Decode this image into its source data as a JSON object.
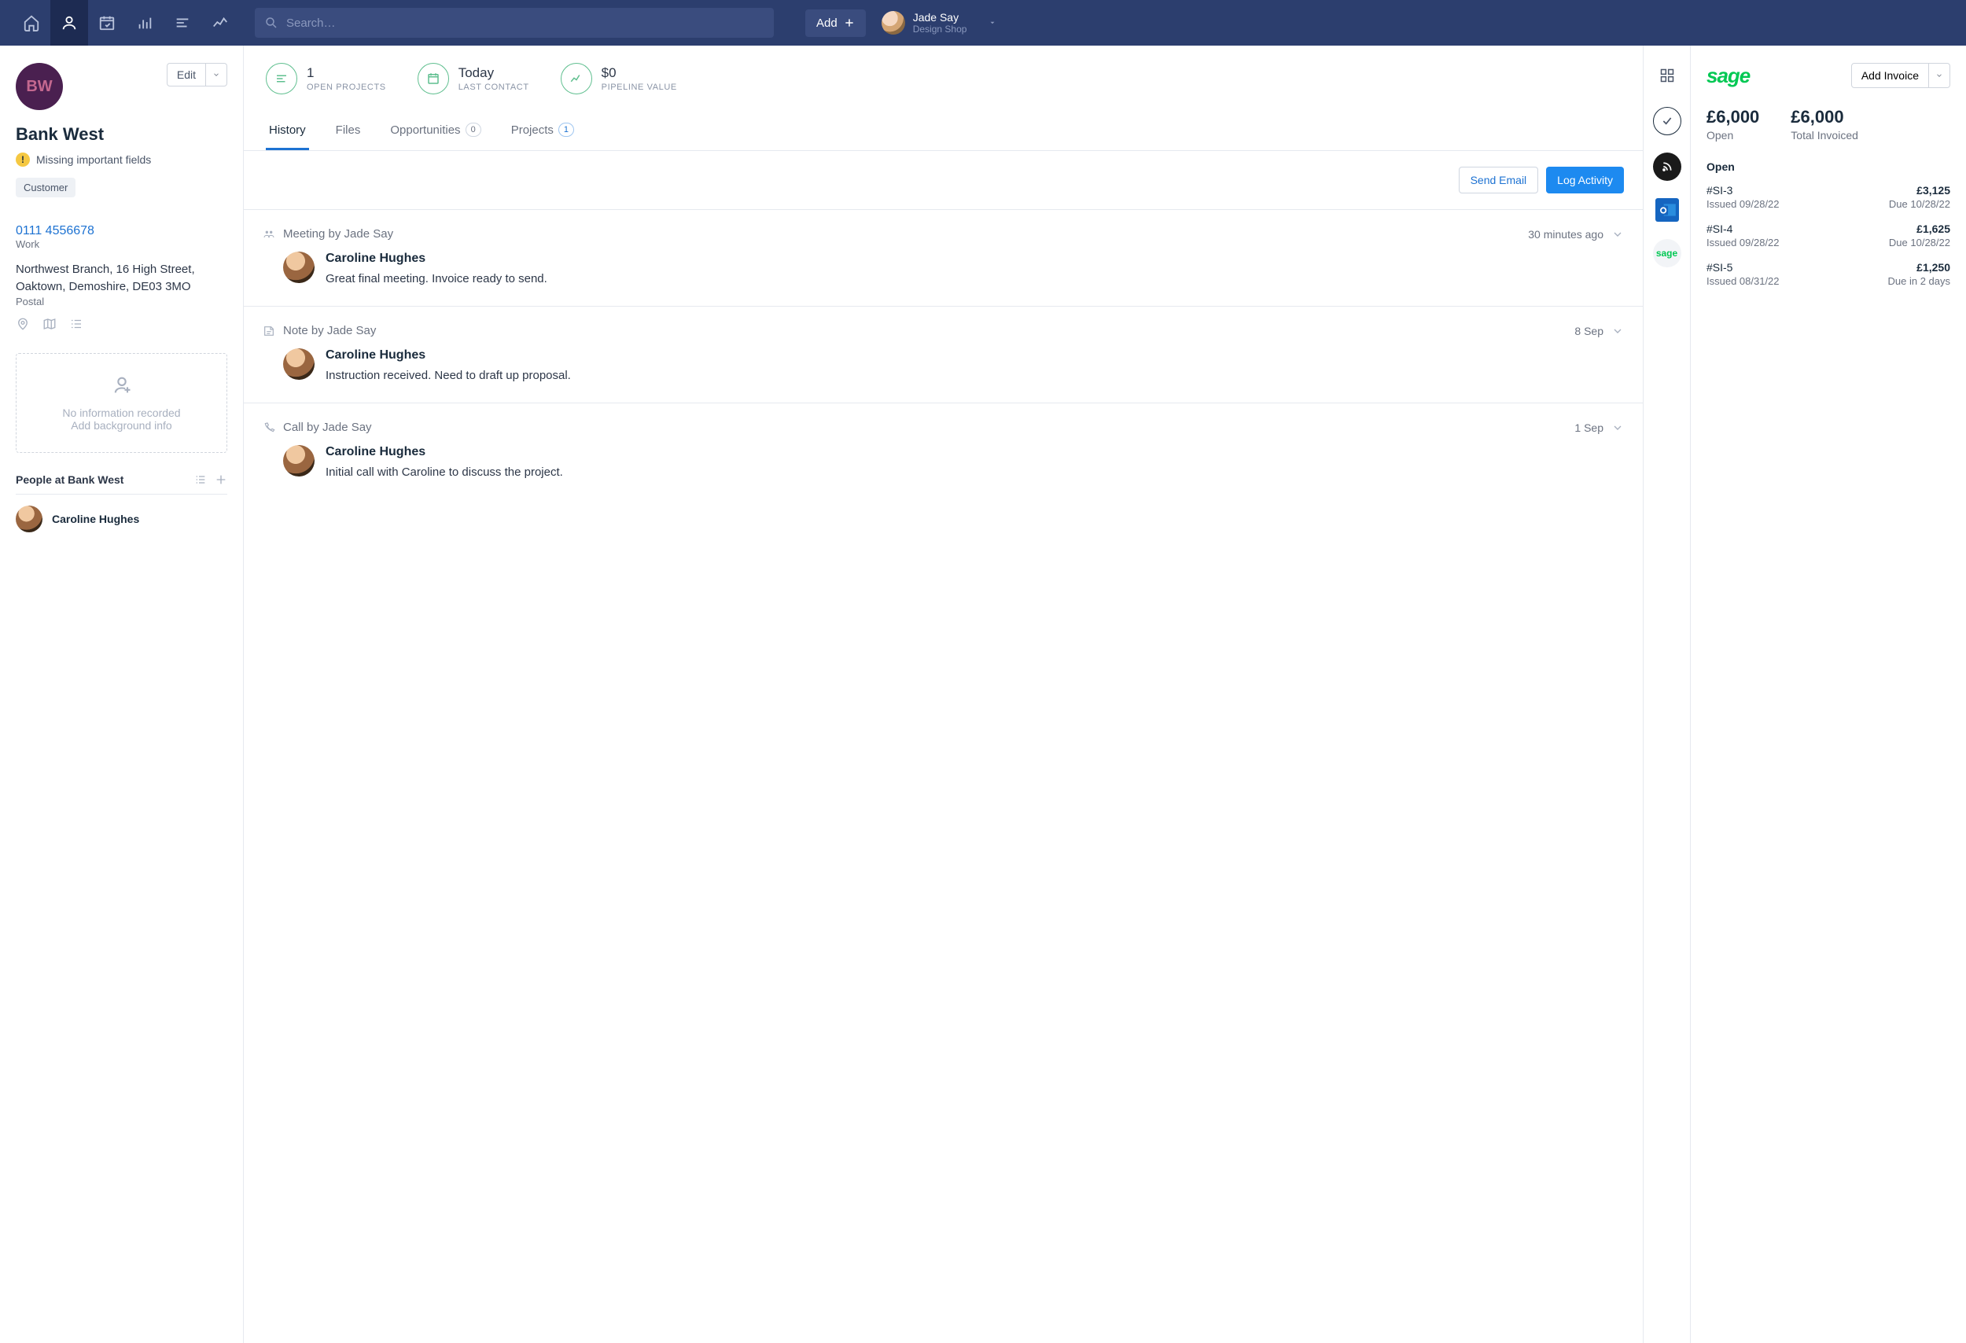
{
  "topbar": {
    "search_placeholder": "Search…",
    "add_label": "Add",
    "user_name": "Jade Say",
    "user_shop": "Design Shop"
  },
  "org": {
    "initials": "BW",
    "name": "Bank West",
    "edit_label": "Edit",
    "alert_text": "Missing important fields",
    "tag": "Customer",
    "phone": "0111 4556678",
    "phone_label": "Work",
    "address_line1": "Northwest Branch, 16 High Street,",
    "address_line2": "Oaktown, Demoshire, DE03 3MO",
    "address_label": "Postal",
    "empty_line1": "No information recorded",
    "empty_line2": "Add background info"
  },
  "people": {
    "heading": "People at Bank West",
    "items": [
      "Caroline Hughes"
    ]
  },
  "kpis": {
    "projects_val": "1",
    "projects_lbl": "Open Projects",
    "contact_val": "Today",
    "contact_lbl": "Last Contact",
    "pipeline_val": "$0",
    "pipeline_lbl": "Pipeline Value"
  },
  "tabs": {
    "history": "History",
    "files": "Files",
    "opportunities": "Opportunities",
    "opportunities_count": "0",
    "projects": "Projects",
    "projects_count": "1"
  },
  "timeline": {
    "send_email": "Send Email",
    "log_activity": "Log Activity",
    "items": [
      {
        "type": "Meeting by Jade Say",
        "time": "30 minutes ago",
        "person": "Caroline Hughes",
        "text": "Great final meeting. Invoice ready to send."
      },
      {
        "type": "Note by Jade Say",
        "time": "8 Sep",
        "person": "Caroline Hughes",
        "text": "Instruction received. Need to draft up proposal."
      },
      {
        "type": "Call by Jade Say",
        "time": "1 Sep",
        "person": "Caroline Hughes",
        "text": "Initial call with Caroline to discuss the project."
      }
    ]
  },
  "sage": {
    "logo": "sage",
    "add_invoice": "Add Invoice",
    "open_val": "£6,000",
    "open_lbl": "Open",
    "invoiced_val": "£6,000",
    "invoiced_lbl": "Total Invoiced",
    "section": "Open",
    "invoices": [
      {
        "id": "#SI-3",
        "issued": "Issued 09/28/22",
        "amount": "£3,125",
        "due": "Due 10/28/22"
      },
      {
        "id": "#SI-4",
        "issued": "Issued 09/28/22",
        "amount": "£1,625",
        "due": "Due 10/28/22"
      },
      {
        "id": "#SI-5",
        "issued": "Issued 08/31/22",
        "amount": "£1,250",
        "due": "Due in 2 days"
      }
    ]
  }
}
